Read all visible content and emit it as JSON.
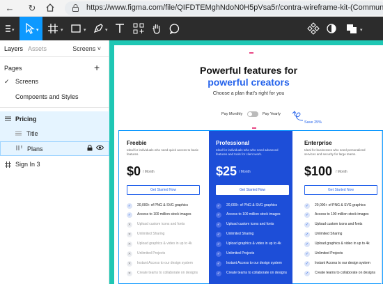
{
  "browser": {
    "url": "https://www.figma.com/file/QIFDTEMghNdoN0H5pVsa5r/contra-wireframe-kit-(Community)?node-id="
  },
  "left_panel": {
    "tabs": [
      "Layers",
      "Assets"
    ],
    "screens_label": "Screens",
    "pages_header": "Pages",
    "add_label": "+",
    "pages": [
      "Screens",
      "Compoents and Styles"
    ],
    "layers": [
      {
        "label": "Pricing"
      },
      {
        "label": "Title"
      },
      {
        "label": "Plans"
      },
      {
        "label": "Sign In 3"
      }
    ]
  },
  "pricing": {
    "title_line1": "Powerful features for",
    "title_line2": "powerful creators",
    "subtitle": "Choose a plan that's right for you",
    "pay_monthly": "Pay Monthly",
    "pay_yearly": "Pay Yearly",
    "save": "Save 25%",
    "per_month": "/ Month",
    "cta": "Get Started Now",
    "plans": [
      {
        "name": "Freebie",
        "desc": "Ideal for individuals who need quick access to basic features.",
        "price": "$0",
        "features": [
          {
            "text": "20,000+ of PNG & SVG graphics",
            "included": true
          },
          {
            "text": "Access to 100 million stock images",
            "included": true
          },
          {
            "text": "Upload custom icons and fonts",
            "included": false
          },
          {
            "text": "Unlimited Sharing",
            "included": false
          },
          {
            "text": "Upload graphics & video in up to 4k",
            "included": false
          },
          {
            "text": "Unlimited Projects",
            "included": false
          },
          {
            "text": "Instant Access to our design system",
            "included": false
          },
          {
            "text": "Create teams to collaborate on designs",
            "included": false
          }
        ]
      },
      {
        "name": "Professional",
        "desc": "Ideal for individuals who who need advanced features and tools for client work.",
        "price": "$25",
        "features": [
          {
            "text": "20,000+ of PNG & SVG graphics",
            "included": true
          },
          {
            "text": "Access to 100 million stock images",
            "included": true
          },
          {
            "text": "Upload custom icons and fonts",
            "included": true
          },
          {
            "text": "Unlimited Sharing",
            "included": true
          },
          {
            "text": "Upload graphics & video in up to 4k",
            "included": true
          },
          {
            "text": "Unlimited Projects",
            "included": true
          },
          {
            "text": "Instant Access to our design system",
            "included": true
          },
          {
            "text": "Create teams to collaborate on designs",
            "included": true
          }
        ]
      },
      {
        "name": "Enterprise",
        "desc": "Ideal for businesses who need personalized services and security for large teams.",
        "price": "$100",
        "features": [
          {
            "text": "20,000+ of PNG & SVG graphics",
            "included": true
          },
          {
            "text": "Access to 100 million stock images",
            "included": true
          },
          {
            "text": "Upload custom icons and fonts",
            "included": true
          },
          {
            "text": "Unlimited Sharing",
            "included": true
          },
          {
            "text": "Upload graphics & video in up to 4k",
            "included": true
          },
          {
            "text": "Unlimited Projects",
            "included": true
          },
          {
            "text": "Instant Access to our design system",
            "included": true
          },
          {
            "text": "Create teams to collaborate on designs",
            "included": true
          }
        ]
      }
    ]
  },
  "colors": {
    "accent": "#0d99ff",
    "brand_blue": "#1d4ed8",
    "canvas_bg": "#1fc7b4",
    "toolbar_bg": "#2c2c2c"
  }
}
